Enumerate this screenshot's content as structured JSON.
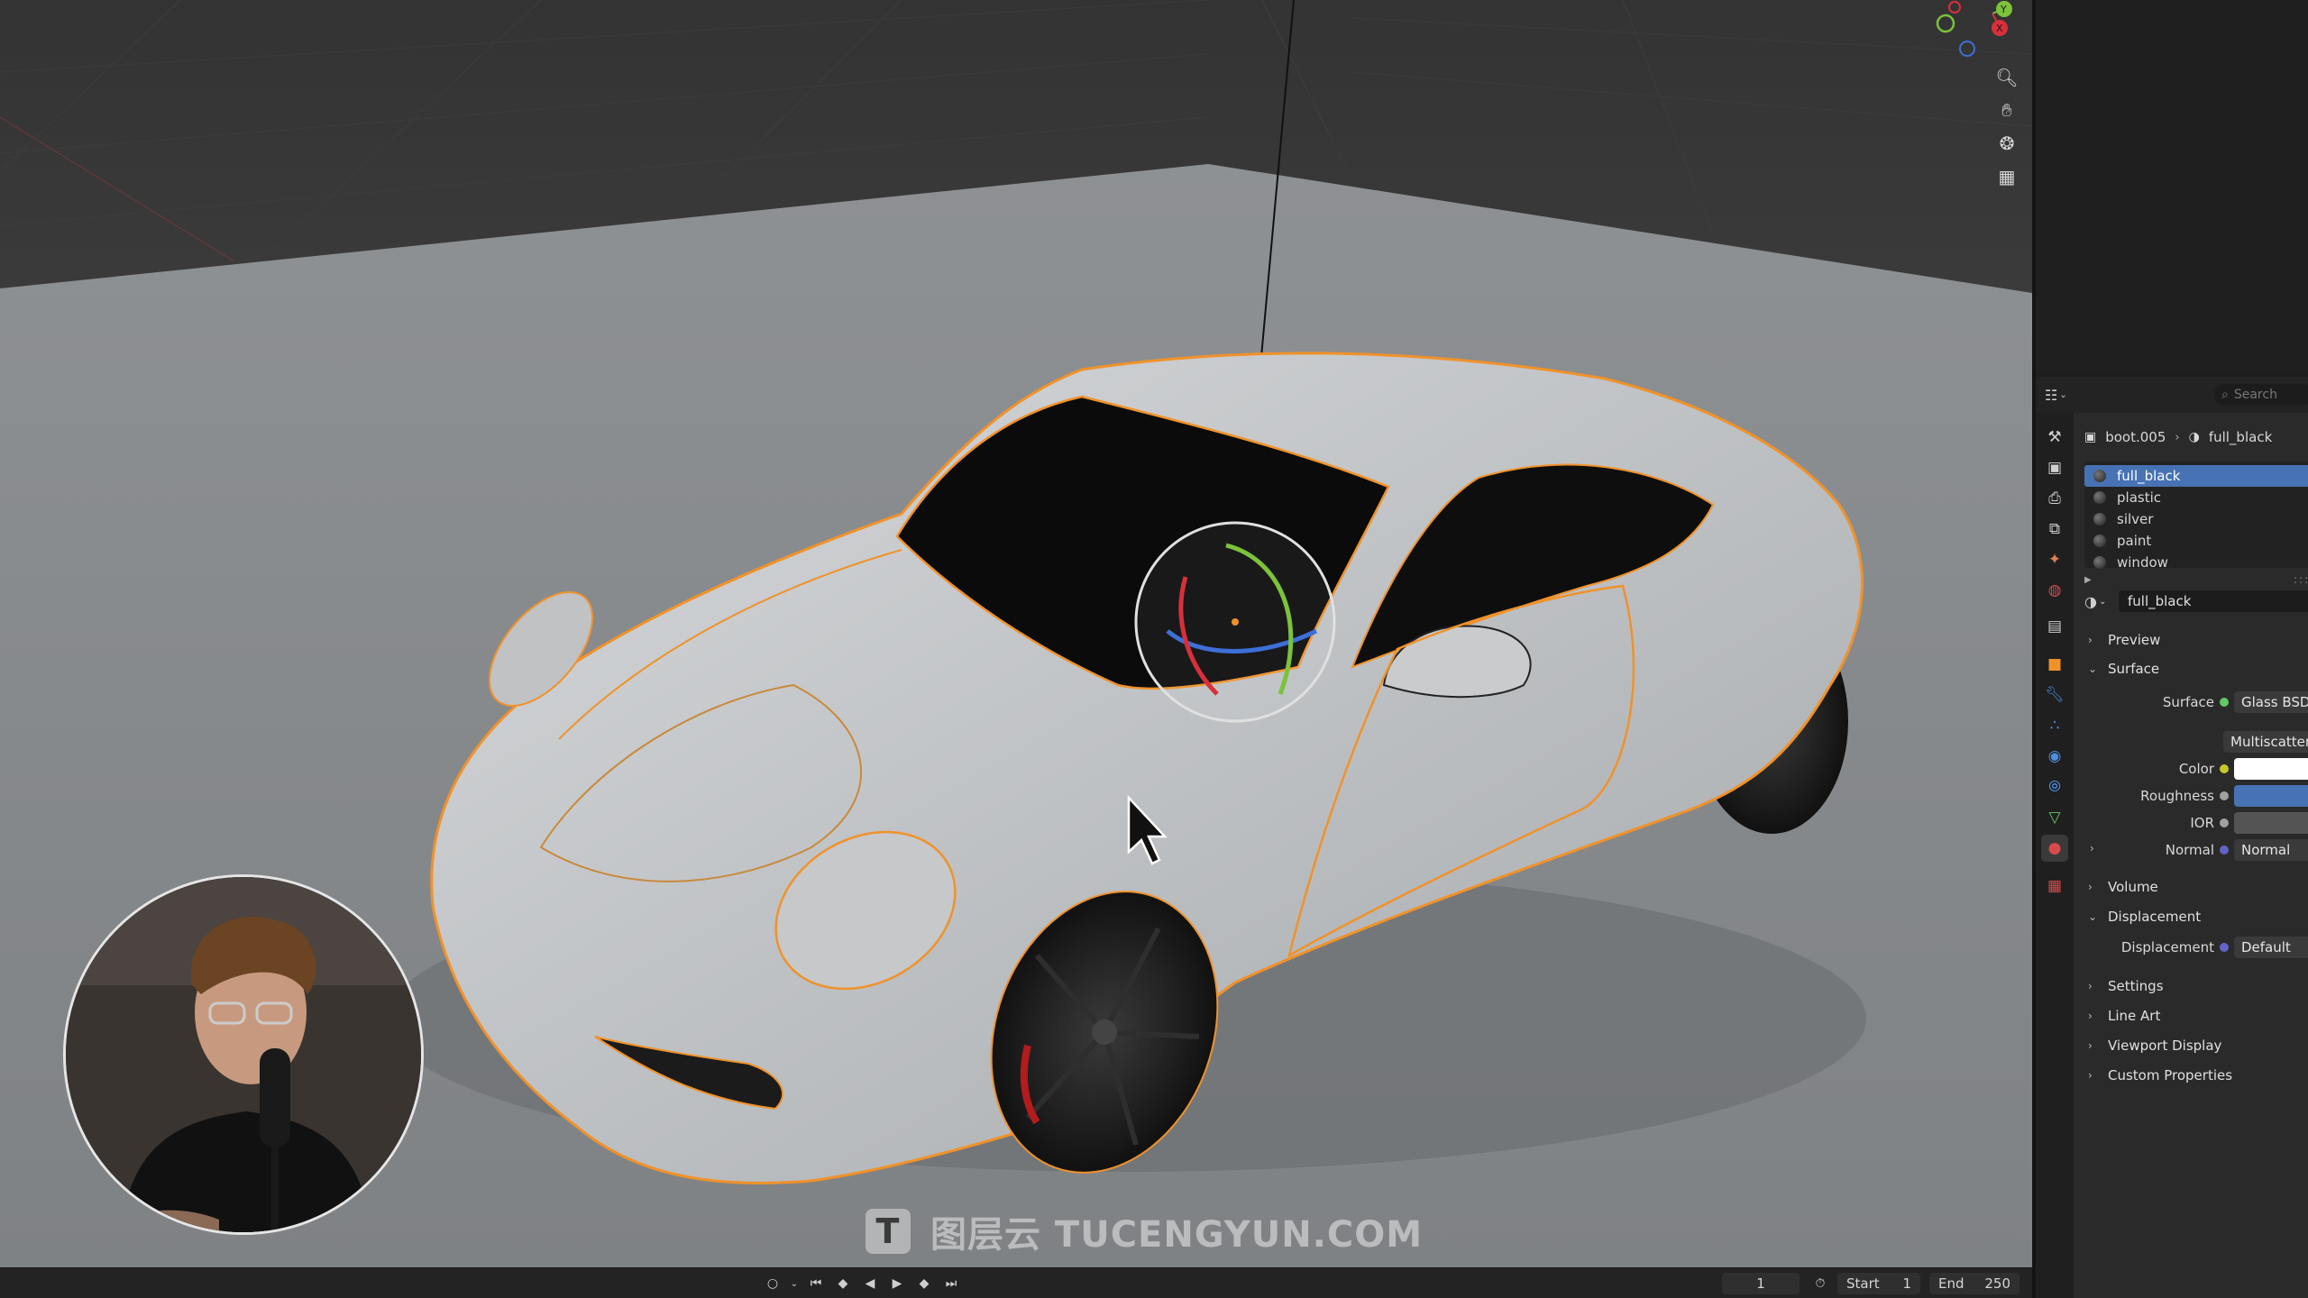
{
  "viewport": {
    "gizmo": {
      "axis_y": "Y",
      "axis_x": "X"
    },
    "nav_buttons": [
      "zoom-icon",
      "hand-icon",
      "camera-icon",
      "grid-icon"
    ],
    "watermark": {
      "logo_letter": "T",
      "text": "图层云  TUCENGYUN.COM"
    }
  },
  "timeline": {
    "current_frame": "1",
    "start_label": "Start",
    "start_value": "1",
    "end_label": "End",
    "end_value": "250"
  },
  "properties": {
    "search_placeholder": "Search",
    "breadcrumb": {
      "object": "boot.005",
      "material": "full_black"
    },
    "materials": [
      "full_black",
      "plastic",
      "silver",
      "paint",
      "window"
    ],
    "active_material": "full_black",
    "panels": {
      "preview": "Preview",
      "surface": "Surface",
      "volume": "Volume",
      "displacement": "Displacement",
      "settings": "Settings",
      "line_art": "Line Art",
      "viewport_display": "Viewport Display",
      "custom_properties": "Custom Properties"
    },
    "surface_rows": {
      "surface_label": "Surface",
      "surface_value": "Glass BSDF",
      "distribution_value": "Multiscatter GGX",
      "color_label": "Color",
      "roughness_label": "Roughness",
      "ior_label": "IOR",
      "normal_label": "Normal",
      "normal_value": "Normal"
    },
    "displacement_rows": {
      "label": "Displacement",
      "value": "Default"
    },
    "colors": {
      "accent": "#4772b3",
      "selection": "#f0922a",
      "socket_green": "#63c763",
      "socket_yellow": "#c7c729",
      "socket_purple": "#6363c7",
      "socket_gray": "#a1a1a1"
    }
  }
}
